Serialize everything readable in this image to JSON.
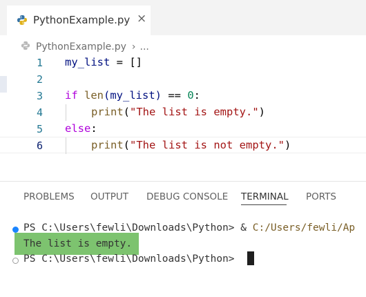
{
  "tab": {
    "filename": "PythonExample.py",
    "close": "×"
  },
  "breadcrumb": {
    "file": "PythonExample.py",
    "separator": "›",
    "more": "..."
  },
  "editor": {
    "lines": [
      {
        "number": "1"
      },
      {
        "number": "2"
      },
      {
        "number": "3"
      },
      {
        "number": "4"
      },
      {
        "number": "5"
      },
      {
        "number": "6"
      }
    ],
    "tokens": {
      "l1_var": "my_list",
      "l1_eq": " = ",
      "l1_val": "[]",
      "l3_if": "if ",
      "l3_len": "len",
      "l3_args": "(my_list)",
      "l3_cmp": " == ",
      "l3_zero": "0",
      "l3_colon": ":",
      "l4_print": "print",
      "l4_open": "(",
      "l4_str": "\"The list is empty.\"",
      "l4_close": ")",
      "l5_else": "else",
      "l5_colon": ":",
      "l6_print": "print",
      "l6_open": "(",
      "l6_str": "\"The list is not empty.\"",
      "l6_close": ")"
    }
  },
  "panel": {
    "tabs": [
      "PROBLEMS",
      "OUTPUT",
      "DEBUG CONSOLE",
      "TERMINAL",
      "PORTS"
    ],
    "active_tab": "TERMINAL"
  },
  "terminal": {
    "prompt1": "PS C:\\Users\\fewli\\Downloads\\Python> & ",
    "command_path": "C:/Users/fewli/Ap",
    "output": "The list is empty.",
    "prompt2": "PS C:\\Users\\fewli\\Downloads\\Python> "
  },
  "colors": {
    "keyword": "#af00db",
    "string": "#a31515",
    "function": "#795e26",
    "number": "#098658",
    "variable": "#001080",
    "output_highlight": "#7dc36f",
    "dot_active": "#1a85ff"
  },
  "icons": {
    "tab_icon": "python-icon",
    "breadcrumb_icon": "python-icon"
  }
}
